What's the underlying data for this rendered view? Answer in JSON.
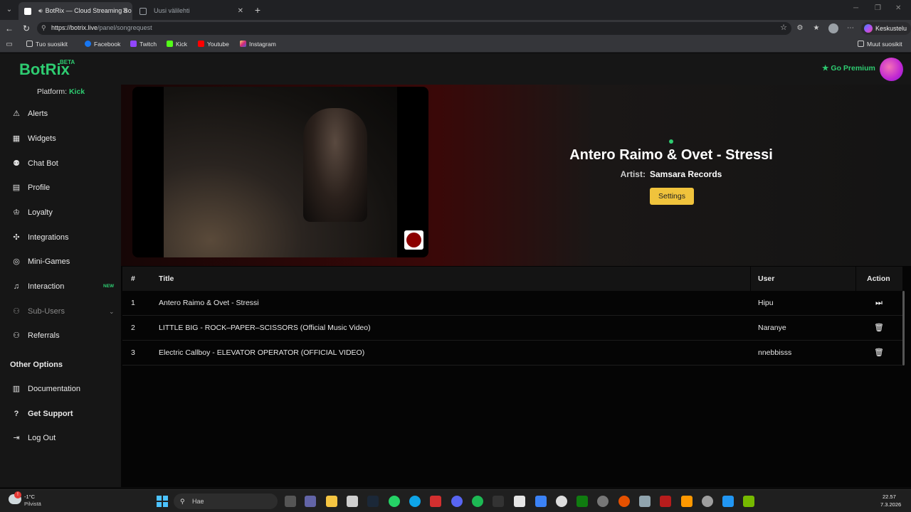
{
  "browser": {
    "tabs": [
      {
        "title": "BotRix — Cloud Streaming Bo",
        "active": true
      },
      {
        "title": "Uusi välilehti",
        "active": false
      }
    ],
    "url_host": "https://botrix.live",
    "url_path": "/panel/songrequest",
    "copilot_label": "Keskustelu",
    "bookmarks": [
      "Tuo suosikit",
      "Facebook",
      "Twitch",
      "Kick",
      "Youtube",
      "Instagram"
    ],
    "other_bookmarks": "Muut suosikit"
  },
  "app": {
    "logo": "BotRix",
    "logo_badge": "BETA",
    "premium_label": "Go Premium",
    "platform_label": "Platform:",
    "platform_value": "Kick",
    "sidebar": [
      {
        "label": "Alerts",
        "icon": "warning-icon"
      },
      {
        "label": "Widgets",
        "icon": "grid-icon"
      },
      {
        "label": "Chat Bot",
        "icon": "robot-icon"
      },
      {
        "label": "Profile",
        "icon": "id-card-icon"
      },
      {
        "label": "Loyalty",
        "icon": "trophy-icon"
      },
      {
        "label": "Integrations",
        "icon": "puzzle-icon"
      },
      {
        "label": "Mini-Games",
        "icon": "gamepad-icon"
      },
      {
        "label": "Interaction",
        "icon": "music-icon",
        "badge": "NEW"
      },
      {
        "label": "Sub-Users",
        "icon": "users-icon"
      },
      {
        "label": "Referrals",
        "icon": "user-group-icon"
      }
    ],
    "other_options_title": "Other Options",
    "other_options": [
      {
        "label": "Documentation",
        "icon": "book-icon"
      },
      {
        "label": "Get Support",
        "icon": "question-icon"
      },
      {
        "label": "Log Out",
        "icon": "logout-icon"
      }
    ]
  },
  "now_playing": {
    "title": "Antero Raimo & Ovet - Stressi",
    "artist_label": "Artist:",
    "artist": "Samsara Records",
    "settings_label": "Settings"
  },
  "queue": {
    "headers": [
      "#",
      "Title",
      "User",
      "Action"
    ],
    "rows": [
      {
        "num": "1",
        "title": "Antero Raimo & Ovet - Stressi",
        "user": "Hipu",
        "action": "skip-icon"
      },
      {
        "num": "2",
        "title": "LITTLE BIG - ROCK–PAPER–SCISSORS (Official Music Video)",
        "user": "Naranye",
        "action": "trash-icon"
      },
      {
        "num": "3",
        "title": "Electric Callboy - ELEVATOR OPERATOR (OFFICIAL VIDEO)",
        "user": "nnebbisss",
        "action": "trash-icon"
      }
    ]
  },
  "taskbar": {
    "temperature": "-1°C",
    "weather": "Pilvistä",
    "search_placeholder": "Hae",
    "time": "22.57",
    "date": "7.3.2026"
  },
  "colors": {
    "accent": "#2ecc71",
    "settings_button": "#f0c33c"
  }
}
